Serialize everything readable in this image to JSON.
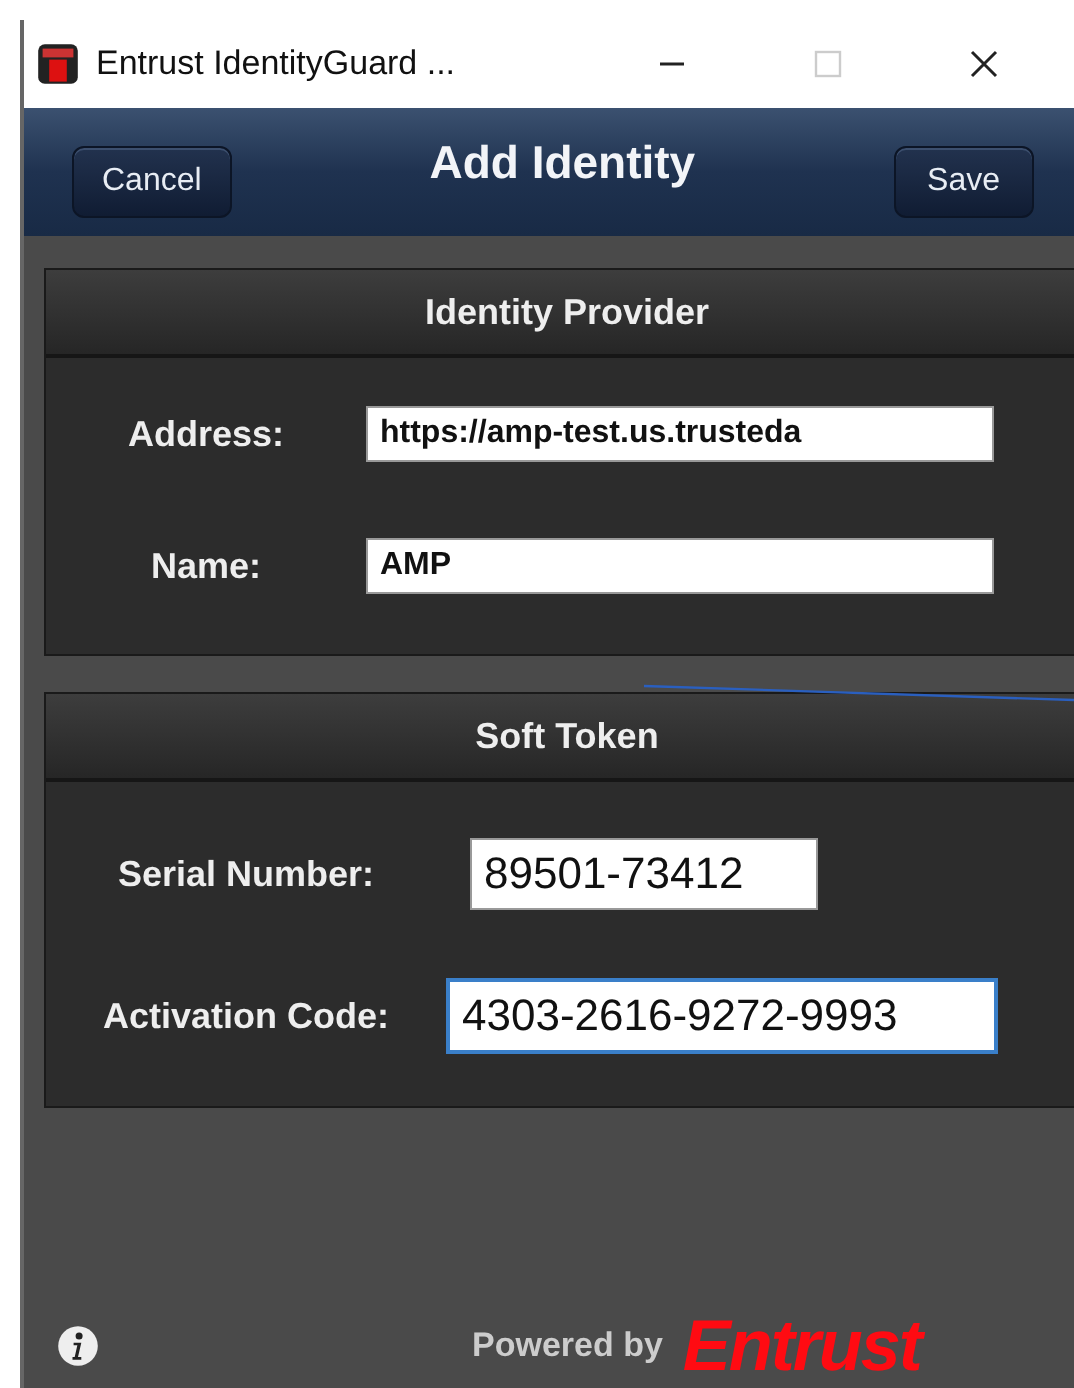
{
  "window": {
    "title": "Entrust IdentityGuard ..."
  },
  "header": {
    "title": "Add Identity",
    "buttons": [
      {
        "label": "Cancel",
        "kind": "left"
      },
      {
        "label": "Save",
        "kind": "right"
      }
    ]
  },
  "sections": [
    {
      "title": "Identity Provider",
      "fields": [
        {
          "label": "Address:",
          "value": "https://amp-test.us.trusteda",
          "focused": false
        },
        {
          "label": "Name:",
          "value": "AMP",
          "focused": false
        }
      ]
    },
    {
      "title": "Soft Token",
      "fields": [
        {
          "label": "Serial Number:",
          "value": "89501-73412",
          "focused": false
        },
        {
          "label": "Activation Code:",
          "value": "4303-2616-9272-9993",
          "focused": true
        }
      ]
    }
  ],
  "footer": {
    "powered_by": "Powered by",
    "brand": "Entrust"
  }
}
